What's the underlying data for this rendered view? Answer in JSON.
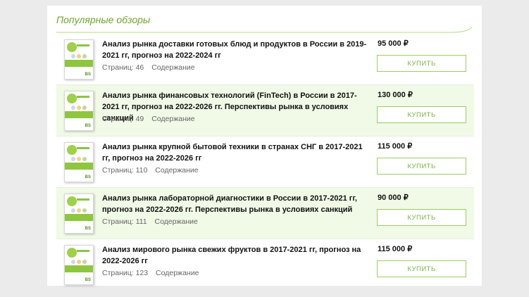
{
  "section": {
    "title": "Популярные обзоры"
  },
  "buy_label": "КУПИТЬ",
  "pages_label": "Страниц:",
  "toc_label": "Содержание",
  "thumb_logo": "BS",
  "colors": {
    "accent": "#7cb342",
    "row_alt": "#f0fae6",
    "title_green": "#6fa52d"
  },
  "reports": [
    {
      "title": "Анализ рынка доставки готовых блюд и продуктов в России в 2019-2021 гг, прогноз на 2022-2024 гг",
      "pages": "46",
      "price": "95 000 ₽"
    },
    {
      "title": "Анализ рынка финансовых технологий (FinTech) в России в 2017-2021 гг, прогноз на 2022-2026 гг. Перспективы рынка в условиях санкций",
      "pages": "49",
      "price": "130 000 ₽"
    },
    {
      "title": "Анализ рынка крупной бытовой техники в странах СНГ в 2017-2021 гг, прогноз на 2022-2026 гг",
      "pages": "110",
      "price": "115 000 ₽"
    },
    {
      "title": "Анализ рынка лабораторной диагностики в России в 2017-2021 гг, прогноз на 2022-2026 гг. Перспективы рынка в условиях санкций",
      "pages": "111",
      "price": "90 000 ₽"
    },
    {
      "title": "Анализ мирового рынка свежих фруктов в 2017-2021 гг, прогноз на 2022-2026 гг",
      "pages": "123",
      "price": "115 000 ₽"
    }
  ]
}
